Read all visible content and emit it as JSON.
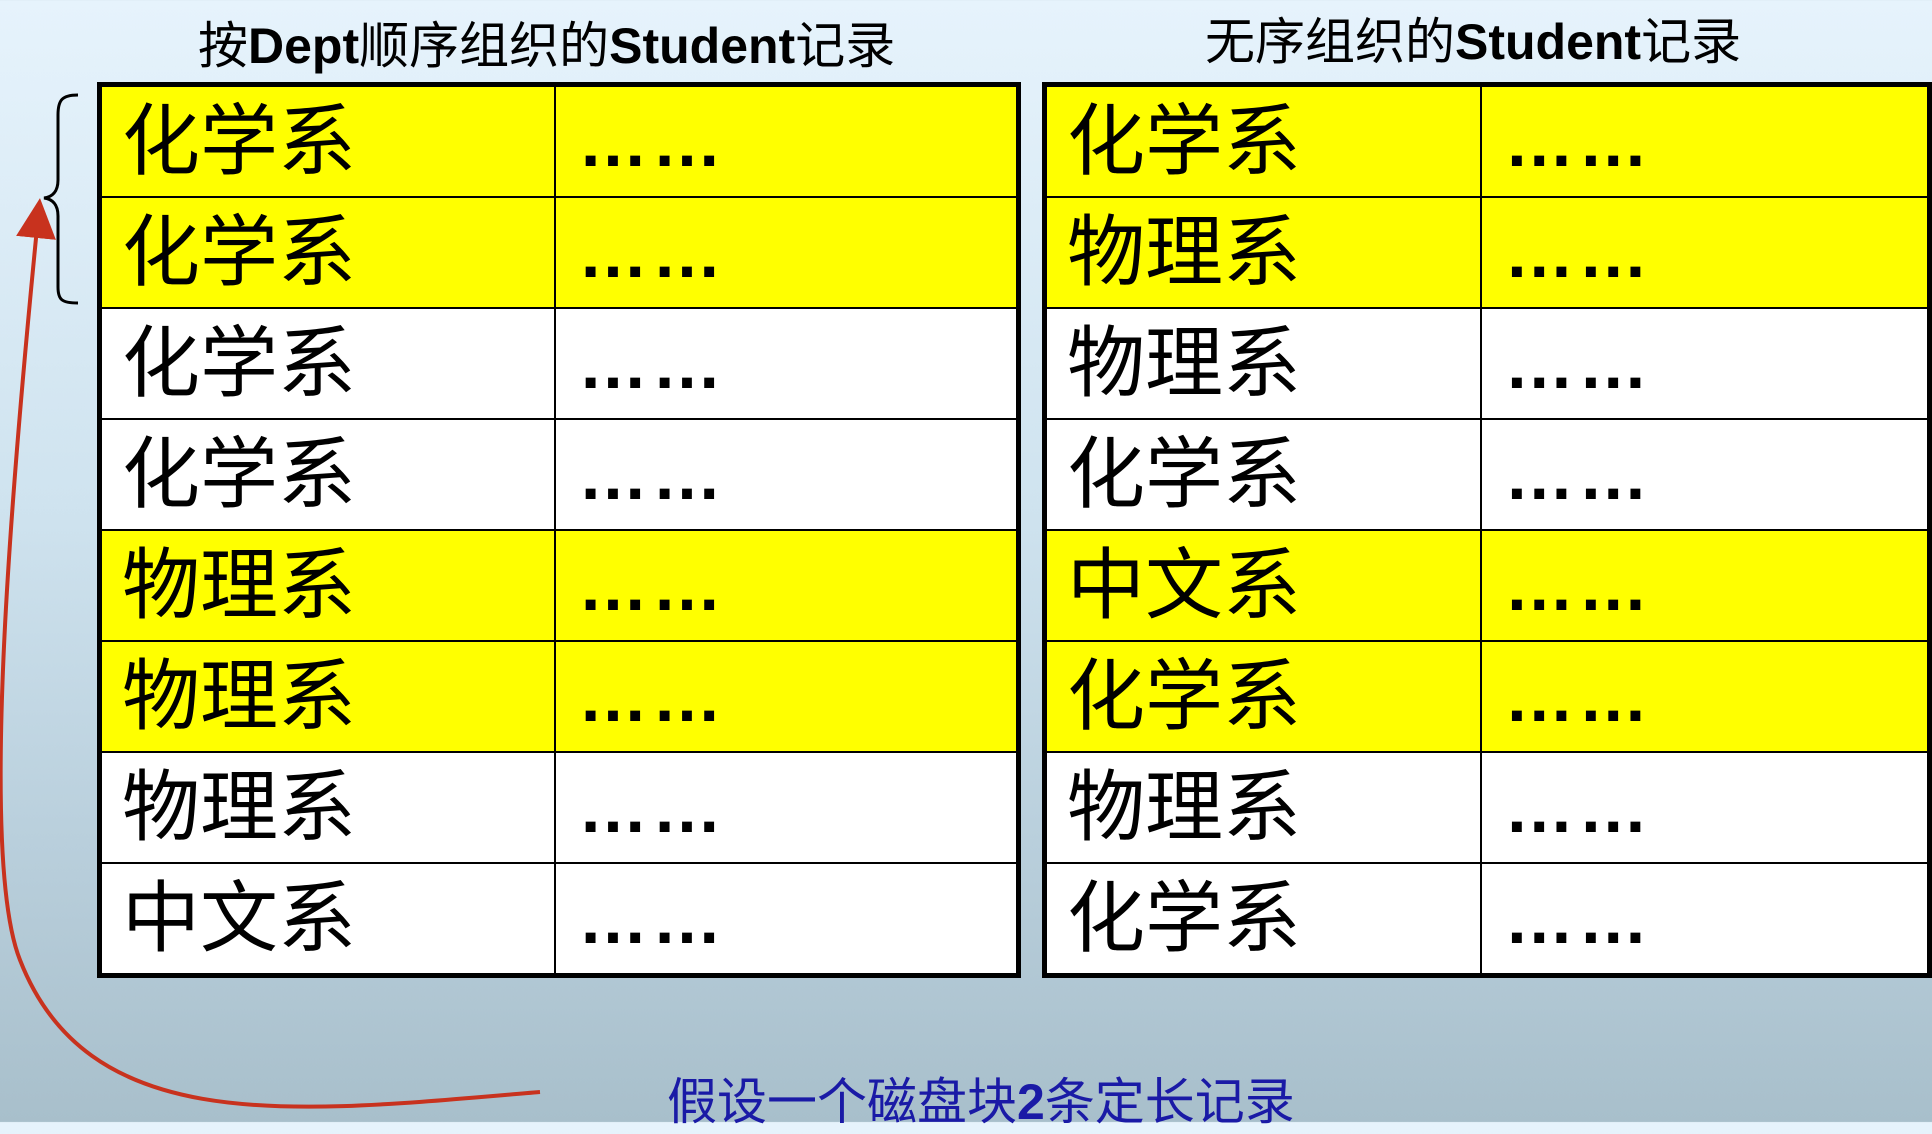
{
  "left_title": {
    "pre": "按",
    "bold1": "Dept",
    "mid": "顺序组织的",
    "bold2": "Student",
    "post": "记录"
  },
  "right_title": {
    "pre": "无序组织的",
    "bold": "Student",
    "post": "记录"
  },
  "left_rows": [
    {
      "dept": "化学系",
      "data": "……",
      "highlight": true
    },
    {
      "dept": "化学系",
      "data": "……",
      "highlight": true
    },
    {
      "dept": "化学系",
      "data": "……",
      "highlight": false
    },
    {
      "dept": "化学系",
      "data": "……",
      "highlight": false
    },
    {
      "dept": "物理系",
      "data": "……",
      "highlight": true
    },
    {
      "dept": "物理系",
      "data": "……",
      "highlight": true
    },
    {
      "dept": "物理系",
      "data": "……",
      "highlight": false
    },
    {
      "dept": "中文系",
      "data": "……",
      "highlight": false
    }
  ],
  "right_rows": [
    {
      "dept": "化学系",
      "data": "……",
      "highlight": true
    },
    {
      "dept": "物理系",
      "data": "……",
      "highlight": true
    },
    {
      "dept": "物理系",
      "data": "……",
      "highlight": false
    },
    {
      "dept": "化学系",
      "data": "……",
      "highlight": false
    },
    {
      "dept": "中文系",
      "data": "……",
      "highlight": true
    },
    {
      "dept": "化学系",
      "data": "……",
      "highlight": true
    },
    {
      "dept": "物理系",
      "data": "……",
      "highlight": false
    },
    {
      "dept": "化学系",
      "data": "……",
      "highlight": false
    }
  ],
  "caption": {
    "pre": "假设一个磁盘块",
    "bold": "2",
    "post": "条定长记录"
  },
  "colors": {
    "highlight": "#ffff00",
    "arrow": "#c8321e",
    "caption": "#1a1aa6"
  }
}
